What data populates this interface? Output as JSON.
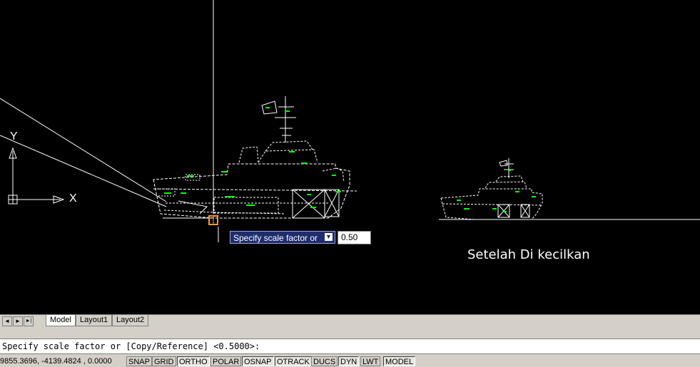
{
  "canvas": {
    "caption": "Setelah Di kecilkan",
    "ucs_x": "X",
    "ucs_y": "Y",
    "dynamic_prompt": "Specify scale factor or",
    "dynamic_prompt_icon": "down-arrow-icon",
    "dynamic_input_value": "0.50"
  },
  "tabs": {
    "nav": [
      "◄",
      "►",
      "►|"
    ],
    "items": [
      {
        "label": "Model",
        "active": true
      },
      {
        "label": "Layout1",
        "active": false
      },
      {
        "label": "Layout2",
        "active": false
      }
    ]
  },
  "command_line": {
    "text": "Specify scale factor or [Copy/Reference] <0.5000>:"
  },
  "status_bar": {
    "coordinates": "9855.3696, -4139.4824 , 0.0000",
    "buttons": [
      {
        "label": "SNAP",
        "on": false
      },
      {
        "label": "GRID",
        "on": false
      },
      {
        "label": "ORTHO",
        "on": true
      },
      {
        "label": "POLAR",
        "on": false
      },
      {
        "label": "OSNAP",
        "on": true
      },
      {
        "label": "OTRACK",
        "on": true
      },
      {
        "label": "DUCS",
        "on": false
      },
      {
        "label": "DYN",
        "on": true
      },
      {
        "label": "LWT",
        "on": false
      },
      {
        "label": "MODEL",
        "on": true
      }
    ]
  },
  "colors": {
    "background": "#000000",
    "drawing_lines": "#ffffff",
    "annotation_green": "#00ff00",
    "prompt_bg": "#1f2c6e",
    "snap_marker": "#ff9933"
  }
}
